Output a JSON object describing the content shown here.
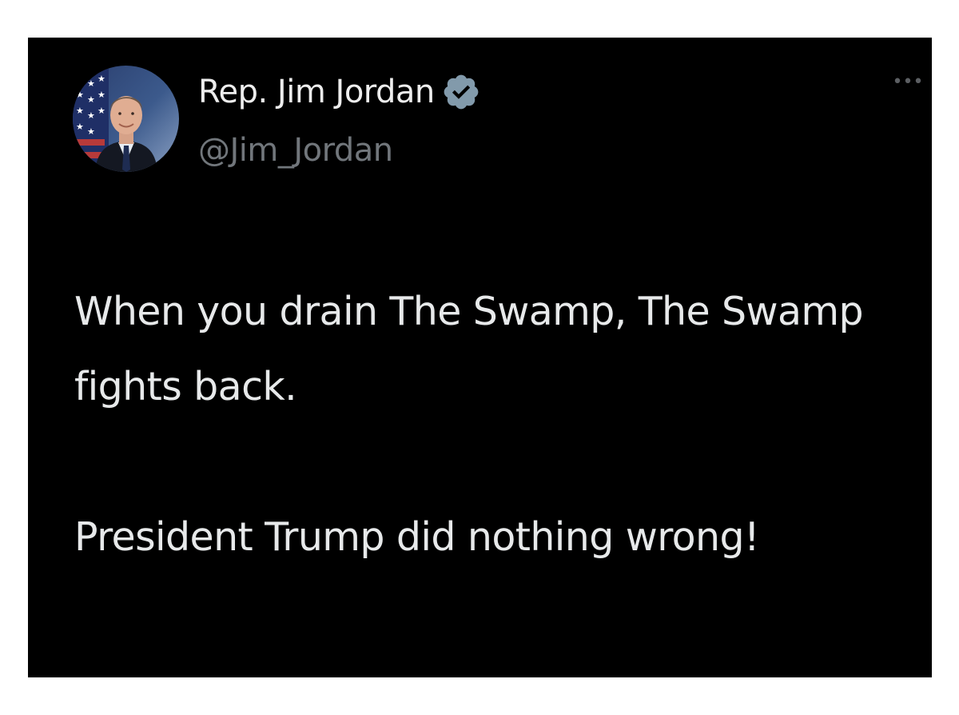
{
  "tweet": {
    "author": {
      "display_name": "Rep. Jim Jordan",
      "handle": "@Jim_Jordan",
      "verified": true,
      "avatar_icon": "profile-photo"
    },
    "menu_icon": "more-dots-icon",
    "paragraphs": [
      "When you drain The Swamp, The Swamp fights back.",
      "President Trump did nothing wrong!"
    ]
  },
  "colors": {
    "background": "#000000",
    "name_text": "#ededed",
    "handle_text": "#71767b",
    "body_text": "#e7e9ea",
    "verified_badge": "#829aab"
  }
}
